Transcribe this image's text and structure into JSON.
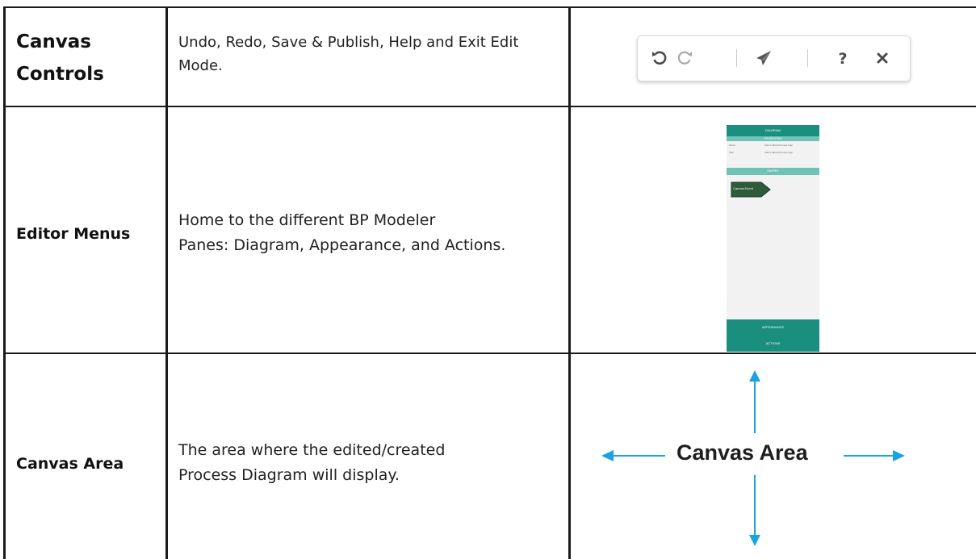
{
  "rows": [
    {
      "feature": "Canvas Controls",
      "description": "Undo, Redo, Save & Publish, Help and Exit Edit Mode.",
      "toolbar": {
        "icons": [
          "undo-icon",
          "redo-icon",
          "publish-icon",
          "help-icon",
          "close-icon"
        ]
      }
    },
    {
      "feature": "Editor Menus",
      "description_lines": [
        "Home to the different BP Modeler",
        "Panes: Diagram, Appearance, and Actions."
      ],
      "panel": {
        "header": "DIAGRAM",
        "section1": "PROPERTIES",
        "prop_rows": [
          {
            "label": "Name",
            "value": "Plan's Afford Process Cap"
          },
          {
            "label": "Title",
            "value": "Plan's Afford Process Cap"
          }
        ],
        "section2": "SHAPES",
        "shape_label": "Canvas Event",
        "footer_items": [
          "APPEARANCE",
          "ACTIONS"
        ]
      }
    },
    {
      "feature": "Canvas Area",
      "description_lines": [
        "The area where the edited/created",
        "Process Diagram will display."
      ],
      "illustration_label": "Canvas Area"
    }
  ],
  "colors": {
    "teal_dark": "#1a8f80",
    "teal_light": "#6fc3b6",
    "arrow_blue": "#1aa3e0"
  }
}
